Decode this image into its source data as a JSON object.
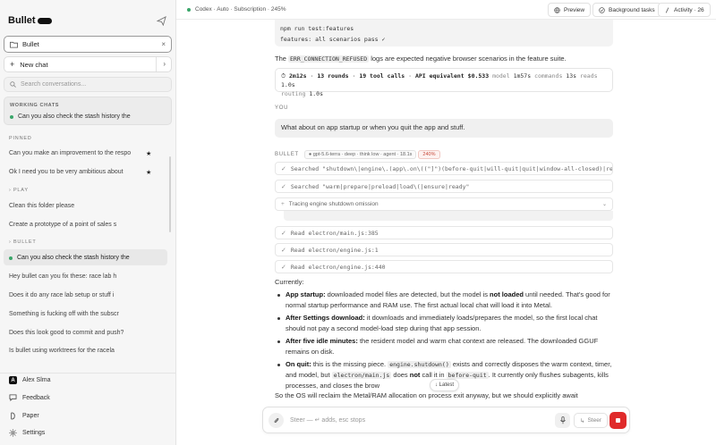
{
  "sidebar": {
    "brand": "Bullet",
    "project": "Bullet",
    "new_chat": "New chat",
    "search_placeholder": "Search conversations...",
    "working": {
      "title": "WORKING CHATS",
      "item": "Can you also check the stash history the"
    },
    "pinned_title": "PINNED",
    "pinned": [
      "Can you make an improvement to the respo",
      "Ok I need you to be very ambitious about"
    ],
    "play_title": "PLAY",
    "play": [
      "Clean this folder please",
      "Create a prototype of a point of sales s"
    ],
    "bullet_title": "BULLET",
    "bullet": [
      "Can you also check the stash history the",
      "Hey bullet can you fix these: race lab h",
      "Does it do any race lab setup or stuff i",
      "Something is fucking off with the subscr",
      "Does this look good to commit and push?",
      "Is bullet using worktrees for the racela"
    ],
    "footer": {
      "user": "Alex Slma",
      "user_initial": "A",
      "feedback": "Feedback",
      "paper": "Paper",
      "settings": "Settings"
    }
  },
  "topbar": {
    "status": "Codex · Auto · Subscription · 245%",
    "preview": "Preview",
    "background_tasks": "Background tasks",
    "activity": "Activity · 26"
  },
  "chat": {
    "code_lines": [
      "npm run test:features",
      "features: all scenarios pass ✓"
    ],
    "msg1_pre": "The ",
    "msg1_code": "ERR_CONNECTION_REFUSED",
    "msg1_post": " logs are expected negative browser scenarios in the feature suite.",
    "stats": {
      "duration": "2m12s",
      "rounds": "13 rounds",
      "tool_calls": "19 tool calls",
      "api_label": "API equivalent",
      "api_cost": "$0.533",
      "model_label": "model",
      "model_time": "1m57s",
      "commands_label": "commands",
      "commands_time": "13s",
      "reads_label": "reads",
      "reads_time": "1.0s",
      "routing_label": "routing",
      "routing_time": "1.0s"
    },
    "you_label": "YOU",
    "you_message": "What about on app startup or when you quit the app and stuff.",
    "bullet_label": "BULLET",
    "chips": {
      "model": "gpt-5.6-terra · deep · think low · agent · 18.1s",
      "percent": "240%"
    },
    "tools": [
      {
        "text": "Searched \"shutdown\\|engine\\.(app\\.on\\((\"]\")(before-quit|will-quit|quit|window-all-closed)|re"
      },
      {
        "text": "Searched \"warm|prepare|preload|load\\(|ensure|ready\""
      },
      {
        "text": "Tracing engine shutdown omission"
      },
      {
        "text": "Read electron/main.js:385"
      },
      {
        "text": "Read electron/engine.js:1"
      },
      {
        "text": "Read electron/engine.js:440"
      }
    ],
    "currently": "Currently:",
    "b1_title": "App startup:",
    "b1_a": " downloaded model files are detected, but the model is ",
    "b1_bold": "not loaded",
    "b1_b": " until needed. That's good for normal startup performance and RAM use. The first actual local chat will load it into Metal.",
    "b2_title": "After Settings download:",
    "b2_text": " it downloads and immediately loads/prepares the model, so the first local chat should not pay a second model-load step during that app session.",
    "b3_title": "After five idle minutes:",
    "b3_text": " the resident model and warm chat context are released. The downloaded GGUF remains on disk.",
    "b4_title": "On quit:",
    "b4_a": " this is the missing piece. ",
    "b4_code1": "engine.shutdown()",
    "b4_b": " exists and correctly disposes the warm context, timer, and model, but ",
    "b4_code2": "electron/main.js",
    "b4_c": " does ",
    "b4_bold": "not",
    "b4_d": " call it in ",
    "b4_code3": "before-quit",
    "b4_e": ". It currently only flushes subagents, kills processes, and closes the brow",
    "tail": "So the OS will reclaim the Metal/RAM allocation on process exit anyway, but we should explicitly await"
  },
  "latest_button": "↓ Latest",
  "composer": {
    "placeholder": "Steer — ↵ adds, esc stops",
    "steer": "Steer"
  }
}
